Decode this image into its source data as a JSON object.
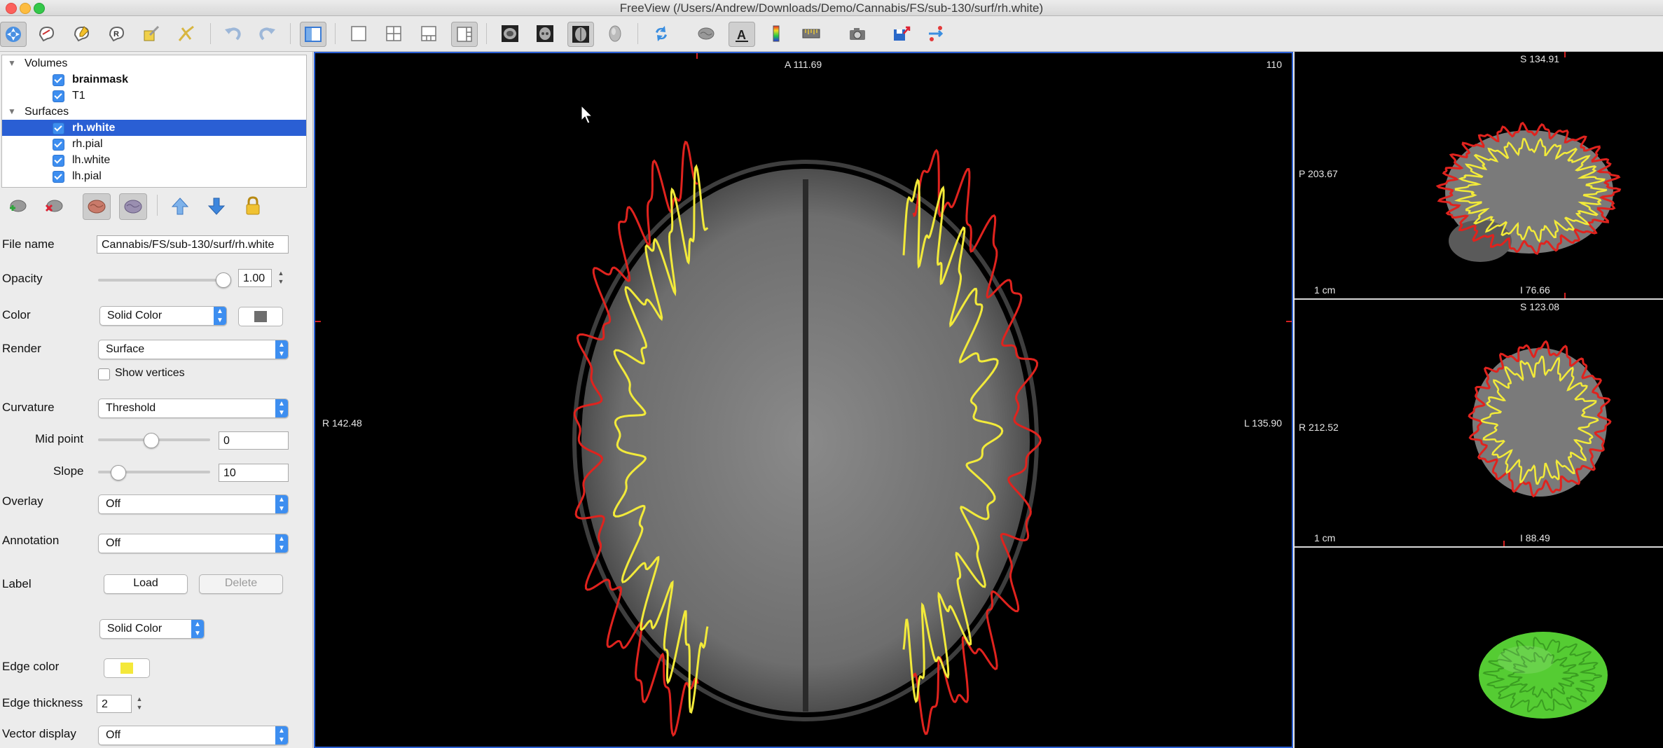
{
  "window": {
    "title": "FreeView (/Users/Andrew/Downloads/Demo/Cannabis/FS/sub-130/surf/rh.white)"
  },
  "toolbar": {
    "buttons": [
      "navigate-icon",
      "voxel-edit-icon",
      "recon-edit-icon",
      "roi-edit-icon",
      "point-set-edit-icon",
      "contour-icon",
      "undo-icon",
      "redo-icon",
      "toggle-panel-icon",
      "layout-1x1-icon",
      "layout-2x2-icon",
      "layout-1x3-icon",
      "layout-1x3-horizontal-icon",
      "sagittal-view-icon",
      "coronal-view-icon",
      "axial-view-icon",
      "3d-view-icon",
      "reset-view-icon",
      "surface-icon",
      "text-annotation-icon",
      "colorbar-icon",
      "ruler-icon",
      "screenshot-icon",
      "save-icon",
      "transform-icon"
    ]
  },
  "layers": {
    "groups": [
      {
        "label": "Volumes",
        "items": [
          {
            "label": "brainmask",
            "bold": true
          },
          {
            "label": "T1",
            "bold": false
          }
        ]
      },
      {
        "label": "Surfaces",
        "items": [
          {
            "label": "rh.white",
            "bold": true,
            "selected": true
          },
          {
            "label": "rh.pial",
            "bold": false
          },
          {
            "label": "lh.white",
            "bold": false
          },
          {
            "label": "lh.pial",
            "bold": false
          }
        ]
      }
    ]
  },
  "properties": {
    "file_name_label": "File name",
    "file_name_value": "Cannabis/FS/sub-130/surf/rh.white",
    "opacity_label": "Opacity",
    "opacity_value": "1.00",
    "opacity_level": 1.0,
    "color_label": "Color",
    "color_mode": "Solid Color",
    "color_swatch": "#6e6e6e",
    "render_label": "Render",
    "render_value": "Surface",
    "show_vertices_label": "Show vertices",
    "curvature_label": "Curvature",
    "curvature_value": "Threshold",
    "midpoint_label": "Mid point",
    "midpoint_value": "0",
    "slope_label": "Slope",
    "slope_value": "10",
    "overlay_label": "Overlay",
    "overlay_value": "Off",
    "annotation_label": "Annotation",
    "annotation_value": "Off",
    "label_label": "Label",
    "load_button": "Load",
    "delete_button": "Delete",
    "label_color_mode": "Solid Color",
    "edge_color_label": "Edge color",
    "edge_color": "#f4e83a",
    "edge_thickness_label": "Edge thickness",
    "edge_thickness_value": "2",
    "vector_display_label": "Vector display",
    "vector_display_value": "Off"
  },
  "main_view": {
    "top_label": "A 111.69",
    "slice_number": "110",
    "left_label": "R 142.48",
    "right_label": "L 135.90"
  },
  "sagittal_view": {
    "top_label": "S 134.91",
    "left_label": "P 203.67",
    "bottom_label": "I 76.66",
    "scale_label": "1 cm"
  },
  "coronal_view": {
    "top_label": "S 123.08",
    "left_label": "R 212.52",
    "bottom_label": "I 88.49",
    "scale_label": "1 cm"
  },
  "colors": {
    "pial_contour": "#e0231e",
    "white_contour": "#f2ea3a",
    "surface_3d": "#55cc33",
    "selection": "#2a5fd4"
  }
}
